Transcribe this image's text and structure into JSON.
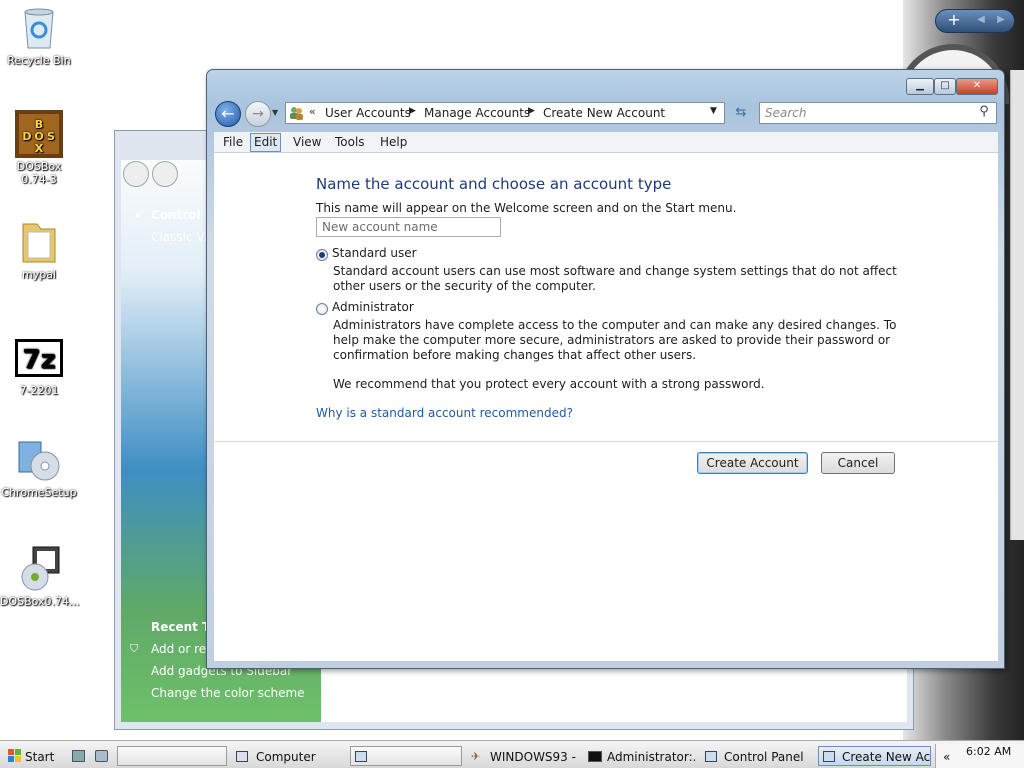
{
  "desktop": {
    "icons": [
      {
        "label": "Recycle Bin",
        "icon": "recycle-bin-icon"
      },
      {
        "label": "DOSBox 0.74-3",
        "icon": "dosbox-icon"
      },
      {
        "label": "mypal",
        "icon": "folder-icon"
      },
      {
        "label": "7-2201",
        "icon": "7zip-icon"
      },
      {
        "label": "ChromeSetup",
        "icon": "setup-icon"
      },
      {
        "label": "DOSBox0.74...",
        "icon": "installer-icon"
      }
    ]
  },
  "background_window": {
    "nav_title": "Control Pa",
    "nav_classic": "Classic Vie",
    "recent_title": "Recent Ta",
    "recent_items": [
      "Add or ren",
      "Add gadgets to Sidebar",
      "Change the color scheme"
    ]
  },
  "window": {
    "breadcrumb": [
      "User Accounts",
      "Manage Accounts",
      "Create New Account"
    ],
    "search_placeholder": "Search",
    "menu": [
      "File",
      "Edit",
      "View",
      "Tools",
      "Help"
    ],
    "heading": "Name the account and choose an account type",
    "note": "This name will appear on the Welcome screen and on the Start menu.",
    "name_input": {
      "value": "New account name"
    },
    "options": [
      {
        "label": "Standard user",
        "selected": true,
        "desc": "Standard account users can use most software and change system settings that do not affect other users or the security of the computer."
      },
      {
        "label": "Administrator",
        "selected": false,
        "desc": "Administrators have complete access to the computer and can make any desired changes. To help make the computer more secure, administrators are asked to provide their password or confirmation before making changes that affect other users."
      }
    ],
    "recommend": "We recommend that you protect every account with a strong password.",
    "link": "Why is a standard account recommended?",
    "buttons": {
      "create": "Create Account",
      "cancel": "Cancel"
    }
  },
  "taskbar": {
    "start": "Start",
    "items": [
      "Computer",
      "WINDOWS93 - ...",
      "Administrator:...",
      "Control Panel",
      "Create New Ac..."
    ],
    "chevron": "«",
    "clock": "6:02 AM"
  }
}
